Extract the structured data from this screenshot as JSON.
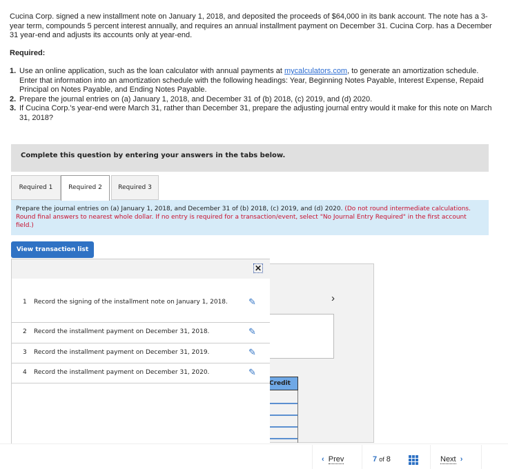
{
  "intro": "Cucina Corp. signed a new installment note on January 1, 2018, and deposited the proceeds of $64,000 in its bank account. The note has a 3-year term, compounds 5 percent interest annually, and requires an annual installment payment on December 31. Cucina Corp. has a December 31 year-end and adjusts its accounts only at year-end.",
  "required_heading": "Required:",
  "requirements": [
    {
      "num": "1.",
      "before": "Use an online application, such as the loan calculator with annual payments at ",
      "link": "mycalculators.com",
      "after": ", to generate an amortization schedule. Enter that information into an amortization schedule with the following headings: Year, Beginning Notes Payable, Interest Expense, Repaid Principal on Notes Payable, and Ending Notes Payable."
    },
    {
      "num": "2.",
      "before": "Prepare the journal entries on (a) January 1, 2018, and December 31 of (b) 2018, (c) 2019, and (d) 2020.",
      "link": "",
      "after": ""
    },
    {
      "num": "3.",
      "before": "If Cucina Corp.'s year-end were March 31, rather than December 31, prepare the adjusting journal entry would it make for this note on March 31, 2018?",
      "link": "",
      "after": ""
    }
  ],
  "banner": "Complete this question by entering your answers in the tabs below.",
  "tabs": [
    {
      "label": "Required 1"
    },
    {
      "label": "Required 2",
      "active": true
    },
    {
      "label": "Required 3"
    }
  ],
  "instruction": {
    "text": "Prepare the journal entries on (a) January 1, 2018, and December 31 of (b) 2018, (c) 2019, and (d) 2020. ",
    "note": "(Do not round intermediate calculations. Round final answers to nearest whole dollar. If no entry is required for a transaction/event, select \"No Journal Entry Required\" in the first account field.)"
  },
  "view_button": "View transaction list",
  "close_label": "✕",
  "transactions": [
    {
      "num": "1",
      "text": "Record the signing of the installment note on January 1, 2018."
    },
    {
      "num": "2",
      "text": "Record the installment payment on December 31, 2018."
    },
    {
      "num": "3",
      "text": "Record the installment payment on December 31, 2019."
    },
    {
      "num": "4",
      "text": "Record the installment payment on December 31, 2020."
    }
  ],
  "credit_header": "Credit",
  "pagination": {
    "prev": "Prev",
    "current": "7",
    "of": "of",
    "total": "8",
    "next": "Next"
  },
  "colors": {
    "accent": "#2f72c4",
    "instruction_bg": "#d6ebf8",
    "note_red": "#c8102e"
  }
}
